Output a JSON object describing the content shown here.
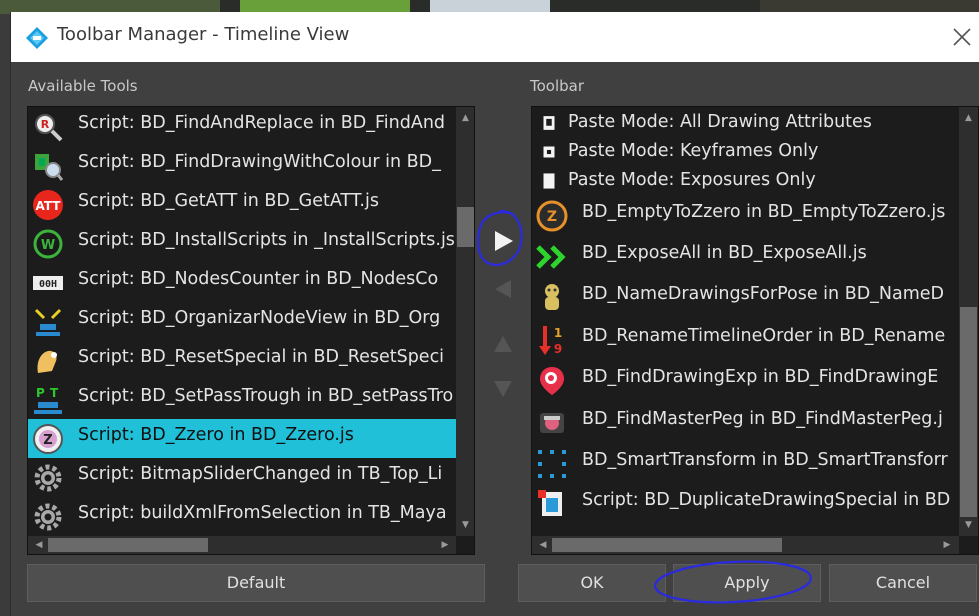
{
  "window": {
    "title": "Toolbar Manager - Timeline View"
  },
  "available_tools": {
    "label": "Available Tools",
    "items": [
      {
        "label": "Script: BD_FindAndReplace in BD_FindAnd",
        "icon": "find-replace-icon",
        "selected": false
      },
      {
        "label": "Script: BD_FindDrawingWithColour in BD_",
        "icon": "find-drawing-colour-icon",
        "selected": false
      },
      {
        "label": "Script: BD_GetATT in BD_GetATT.js",
        "icon": "att-icon",
        "selected": false
      },
      {
        "label": "Script: BD_InstallScripts in _InstallScripts.js",
        "icon": "install-icon",
        "selected": false
      },
      {
        "label": "Script: BD_NodesCounter in BD_NodesCo",
        "icon": "counter-icon",
        "selected": false
      },
      {
        "label": "Script: BD_OrganizarNodeView in BD_Org",
        "icon": "organize-nodes-icon",
        "selected": false
      },
      {
        "label": "Script: BD_ResetSpecial in BD_ResetSpeci",
        "icon": "reset-special-icon",
        "selected": false
      },
      {
        "label": "Script: BD_SetPassTrough in BD_setPassTro",
        "icon": "pass-through-icon",
        "selected": false
      },
      {
        "label": "Script: BD_Zzero in BD_Zzero.js",
        "icon": "zzero-icon",
        "selected": true
      },
      {
        "label": "Script: BitmapSliderChanged in TB_Top_Li",
        "icon": "gear-icon",
        "selected": false
      },
      {
        "label": "Script: buildXmlFromSelection in TB_Maya",
        "icon": "gear-icon",
        "selected": false
      }
    ]
  },
  "toolbar": {
    "label": "Toolbar",
    "items": [
      {
        "label": "Paste Mode: All Drawing Attributes",
        "icon": "paste-all-icon"
      },
      {
        "label": "Paste Mode: Keyframes Only",
        "icon": "paste-keyframes-icon"
      },
      {
        "label": "Paste Mode: Exposures Only",
        "icon": "paste-exposures-icon"
      },
      {
        "label": "BD_EmptyToZzero in BD_EmptyToZzero.js",
        "icon": "empty-to-zzero-icon"
      },
      {
        "label": "BD_ExposeAll in BD_ExposeAll.js",
        "icon": "expose-all-icon"
      },
      {
        "label": "BD_NameDrawingsForPose in BD_NameD",
        "icon": "name-drawings-icon"
      },
      {
        "label": "BD_RenameTimelineOrder in BD_Rename",
        "icon": "rename-order-icon"
      },
      {
        "label": "BD_FindDrawingExp in BD_FindDrawingE",
        "icon": "find-drawing-exp-icon"
      },
      {
        "label": "BD_FindMasterPeg in BD_FindMasterPeg.j",
        "icon": "master-peg-icon"
      },
      {
        "label": "BD_SmartTransform in BD_SmartTransforr",
        "icon": "smart-transform-icon"
      },
      {
        "label": "Script: BD_DuplicateDrawingSpecial in BD",
        "icon": "duplicate-drawing-icon"
      }
    ]
  },
  "buttons": {
    "default": "Default",
    "ok": "OK",
    "apply": "Apply",
    "cancel": "Cancel"
  },
  "colors": {
    "selection": "#20c0d8",
    "annotation": "#2a2ae0",
    "list_bg": "#1c1c1c",
    "dialog_bg": "#404040"
  }
}
